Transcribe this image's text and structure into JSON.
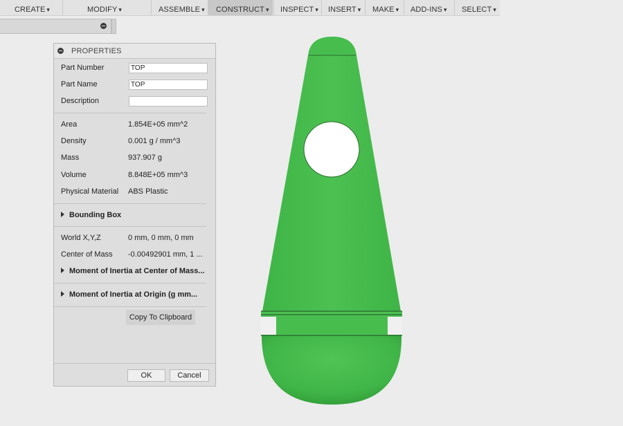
{
  "toolbar": {
    "items": [
      {
        "label": "CREATE"
      },
      {
        "label": "MODIFY"
      },
      {
        "label": "ASSEMBLE"
      },
      {
        "label": "CONSTRUCT"
      },
      {
        "label": "INSPECT"
      },
      {
        "label": "INSERT"
      },
      {
        "label": "MAKE"
      },
      {
        "label": "ADD-INS"
      },
      {
        "label": "SELECT"
      }
    ],
    "caret": "▾",
    "active_item": "CONSTRUCT"
  },
  "properties": {
    "title": "PROPERTIES",
    "part_number": {
      "label": "Part Number",
      "value": "TOP"
    },
    "part_name": {
      "label": "Part Name",
      "value": "TOP"
    },
    "description": {
      "label": "Description",
      "value": ""
    },
    "area": {
      "label": "Area",
      "value": "1.854E+05 mm^2"
    },
    "density": {
      "label": "Density",
      "value": "0.001 g / mm^3"
    },
    "mass": {
      "label": "Mass",
      "value": "937.907 g"
    },
    "volume": {
      "label": "Volume",
      "value": "8.848E+05 mm^3"
    },
    "material": {
      "label": "Physical Material",
      "value": "ABS Plastic"
    },
    "bounding_box": {
      "label": "Bounding Box"
    },
    "world_xyz": {
      "label": "World X,Y,Z",
      "value": "0 mm, 0 mm, 0 mm"
    },
    "center_of_mass": {
      "label": "Center of Mass",
      "value": "-0.00492901 mm, 1 ..."
    },
    "moi_center": {
      "label": "Moment of Inertia at Center of Mass..."
    },
    "moi_origin": {
      "label": "Moment of Inertia at Origin   (g mm..."
    },
    "copy_button": "Copy To Clipboard",
    "ok_button": "OK",
    "cancel_button": "Cancel"
  },
  "colors": {
    "model_green": "#4cc152",
    "model_green_dark": "#2f9a36",
    "toolbar_active": "#c8c8c8"
  }
}
